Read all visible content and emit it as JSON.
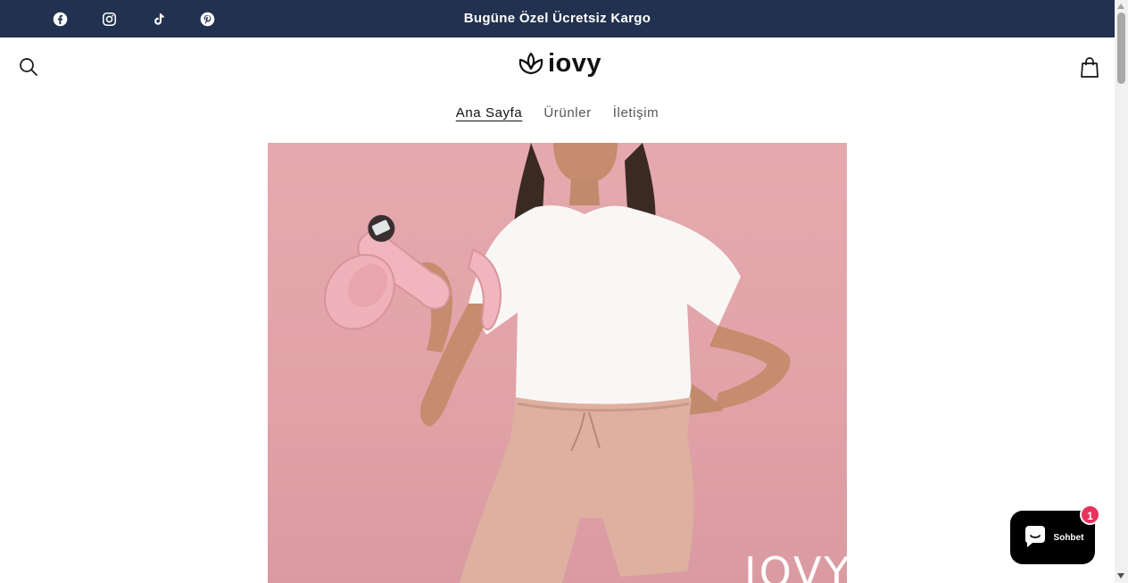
{
  "announcement": {
    "text": "Bugüne Özel Ücretsiz Kargo",
    "social": [
      "facebook-icon",
      "instagram-icon",
      "tiktok-icon",
      "pinterest-icon"
    ]
  },
  "header": {
    "logo_text": "iovy",
    "search_icon": "search-icon",
    "cart_icon": "cart-icon"
  },
  "nav": {
    "items": [
      {
        "label": "Ana Sayfa",
        "active": true
      },
      {
        "label": "Ürünler",
        "active": false
      },
      {
        "label": "İletişim",
        "active": false
      }
    ]
  },
  "hero": {
    "brand_overlay": "IOVY",
    "background_color": "#e1a3a8"
  },
  "chat": {
    "label": "Sohbet",
    "badge": "1"
  },
  "colors": {
    "announcement_bg": "#22314f",
    "badge": "#e8325c"
  }
}
